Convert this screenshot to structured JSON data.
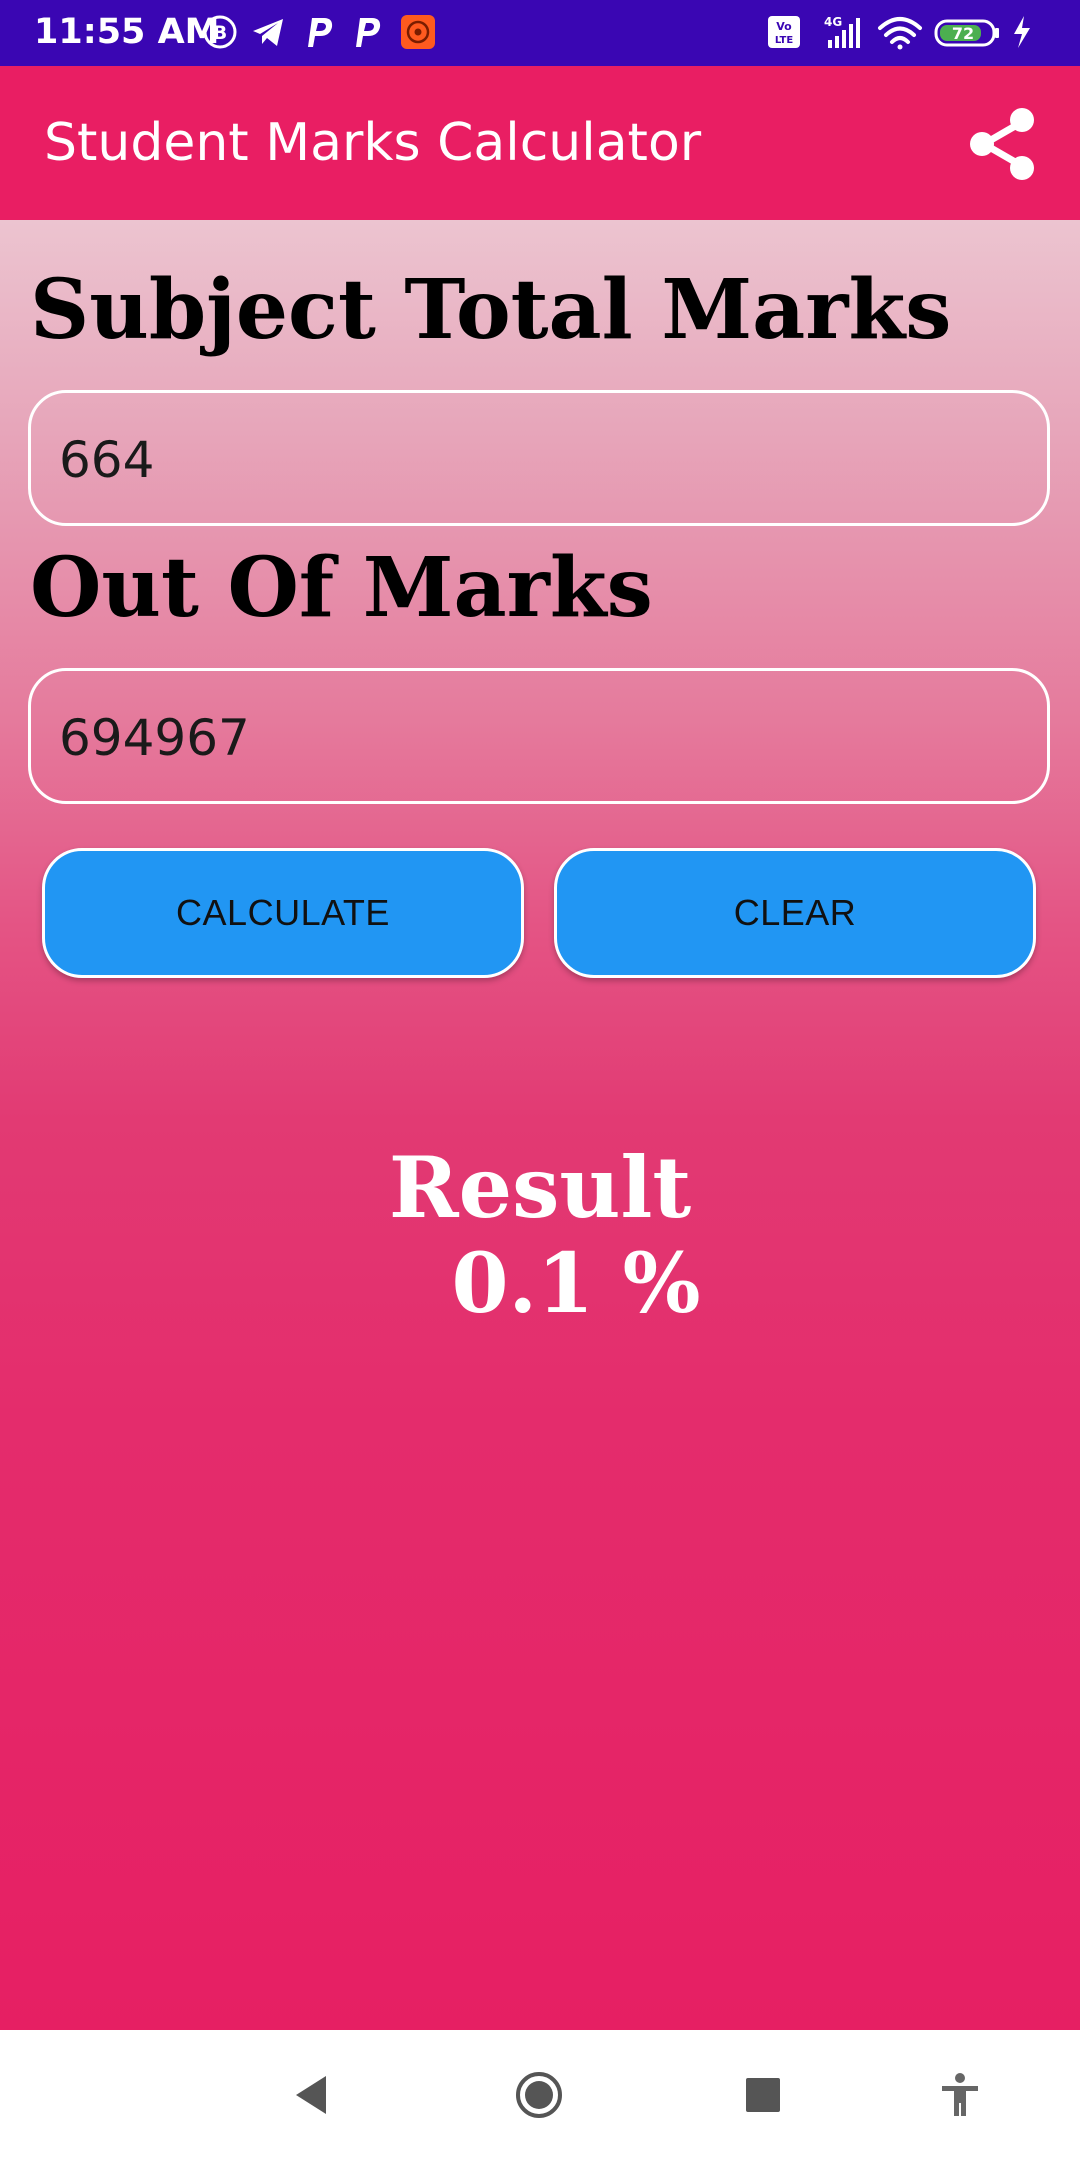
{
  "status_bar": {
    "time": "11:55 AM",
    "left_icons": [
      "b-circle-icon",
      "telegram-icon",
      "p-icon",
      "p-icon",
      "app-notification-icon"
    ],
    "right_icons": [
      "volte-icon",
      "4g-signal-icon",
      "wifi-icon",
      "battery-icon",
      "charging-icon"
    ],
    "network_label": "4G",
    "volte_label": "Vo LTE",
    "battery_level": "72"
  },
  "app_bar": {
    "title": "Student Marks Calculator",
    "share_icon": "share-icon",
    "background_color": "#e91e63"
  },
  "form": {
    "subject_total_label": "Subject Total Marks",
    "subject_total_value": "664",
    "out_of_label": "Out Of Marks",
    "out_of_value": "694967",
    "calculate_label": "CALCULATE",
    "clear_label": "CLEAR",
    "button_color": "#2196f3"
  },
  "result": {
    "label": "Result",
    "value": "0.1 %"
  },
  "nav_bar": {
    "icons": [
      "back-icon",
      "home-icon",
      "recents-icon",
      "accessibility-icon"
    ]
  }
}
